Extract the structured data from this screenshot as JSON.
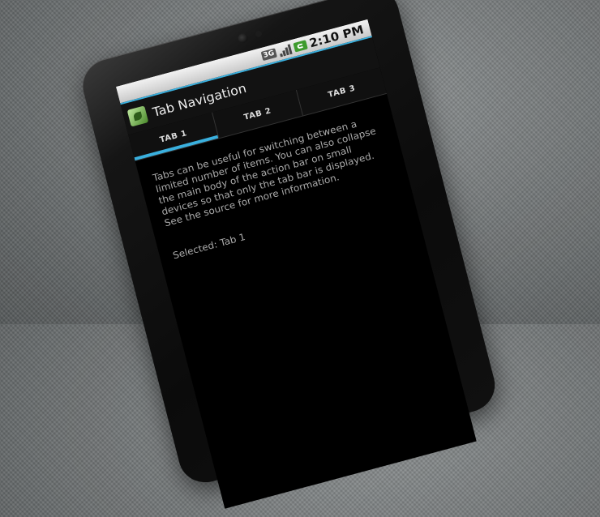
{
  "status_bar": {
    "network": "3G",
    "time": "2:10 PM"
  },
  "action_bar": {
    "title": "Tab Navigation"
  },
  "tabs": [
    {
      "label": "TAB 1",
      "selected": true
    },
    {
      "label": "TAB 2",
      "selected": false
    },
    {
      "label": "TAB 3",
      "selected": false
    }
  ],
  "content": {
    "description": "Tabs can be useful for switching between a limited number of items. You can also collapse the main body of the action bar on small devices so that only the tab bar is displayed. See the source for more information.",
    "selected_text": "Selected: Tab 1"
  },
  "colors": {
    "accent": "#3ab0de",
    "battery": "#3e9b2e"
  },
  "icons": [
    "camera-icon",
    "signal-icon",
    "battery-icon",
    "app-icon"
  ]
}
